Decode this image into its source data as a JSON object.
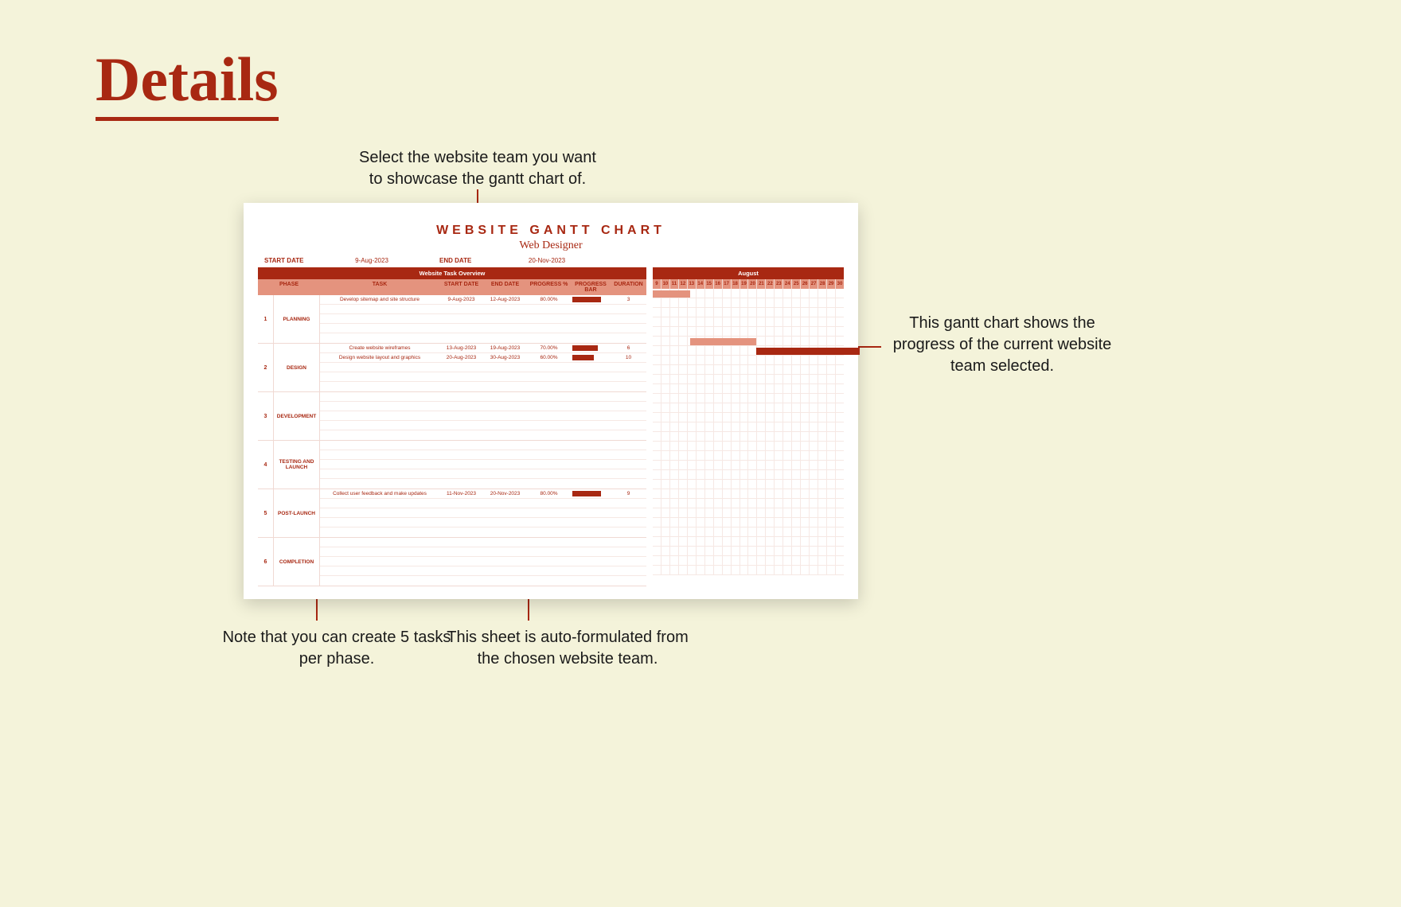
{
  "page": {
    "title": "Details"
  },
  "annotations": {
    "top": "Select the website team you want to showcase the gantt chart of.",
    "right": "This gantt chart shows the progress of the current website team selected.",
    "bottom_left": "Note that you can create 5 tasks per phase.",
    "bottom_right": "This sheet is auto-formulated from the chosen website team."
  },
  "chart": {
    "title": "WEBSITE GANTT CHART",
    "subtitle": "Web Designer",
    "start_date_label": "START DATE",
    "start_date_value": "9-Aug-2023",
    "end_date_label": "END DATE",
    "end_date_value": "20-Nov-2023",
    "overview_label": "Website Task Overview",
    "month_label": "August",
    "columns": {
      "phase": "PHASE",
      "task": "TASK",
      "start": "START DATE",
      "end": "END DATE",
      "progress": "PROGRESS %",
      "progress_bar": "PROGRESS BAR",
      "duration": "DURATION"
    },
    "days": [
      "9",
      "10",
      "11",
      "12",
      "13",
      "14",
      "15",
      "16",
      "17",
      "18",
      "19",
      "20",
      "21",
      "22",
      "23",
      "24",
      "25",
      "26",
      "27",
      "28",
      "29",
      "30"
    ],
    "phases": [
      {
        "num": "1",
        "name": "PLANNING",
        "tasks": [
          {
            "task": "Develop sitemap and site structure",
            "start": "9-Aug-2023",
            "end": "12-Aug-2023",
            "progress": "80.00%",
            "bar_pct": 80,
            "duration": "3",
            "g_start": 0,
            "g_span": 4
          },
          null,
          null,
          null,
          null
        ]
      },
      {
        "num": "2",
        "name": "DESIGN",
        "tasks": [
          {
            "task": "Create website wireframes",
            "start": "13-Aug-2023",
            "end": "19-Aug-2023",
            "progress": "70.00%",
            "bar_pct": 70,
            "duration": "6",
            "g_start": 4,
            "g_span": 7
          },
          {
            "task": "Design website layout and graphics",
            "start": "20-Aug-2023",
            "end": "30-Aug-2023",
            "progress": "60.00%",
            "bar_pct": 60,
            "duration": "10",
            "g_start": 11,
            "g_span": 11,
            "dark": true
          },
          null,
          null,
          null
        ]
      },
      {
        "num": "3",
        "name": "DEVELOPMENT",
        "tasks": [
          null,
          null,
          null,
          null,
          null
        ]
      },
      {
        "num": "4",
        "name": "TESTING AND LAUNCH",
        "tasks": [
          null,
          null,
          null,
          null,
          null
        ]
      },
      {
        "num": "5",
        "name": "POST-LAUNCH",
        "tasks": [
          {
            "task": "Collect user feedback and make updates",
            "start": "11-Nov-2023",
            "end": "20-Nov-2023",
            "progress": "80.00%",
            "bar_pct": 80,
            "duration": "9"
          },
          null,
          null,
          null,
          null
        ]
      },
      {
        "num": "6",
        "name": "COMPLETION",
        "tasks": [
          null,
          null,
          null,
          null,
          null
        ]
      }
    ]
  }
}
